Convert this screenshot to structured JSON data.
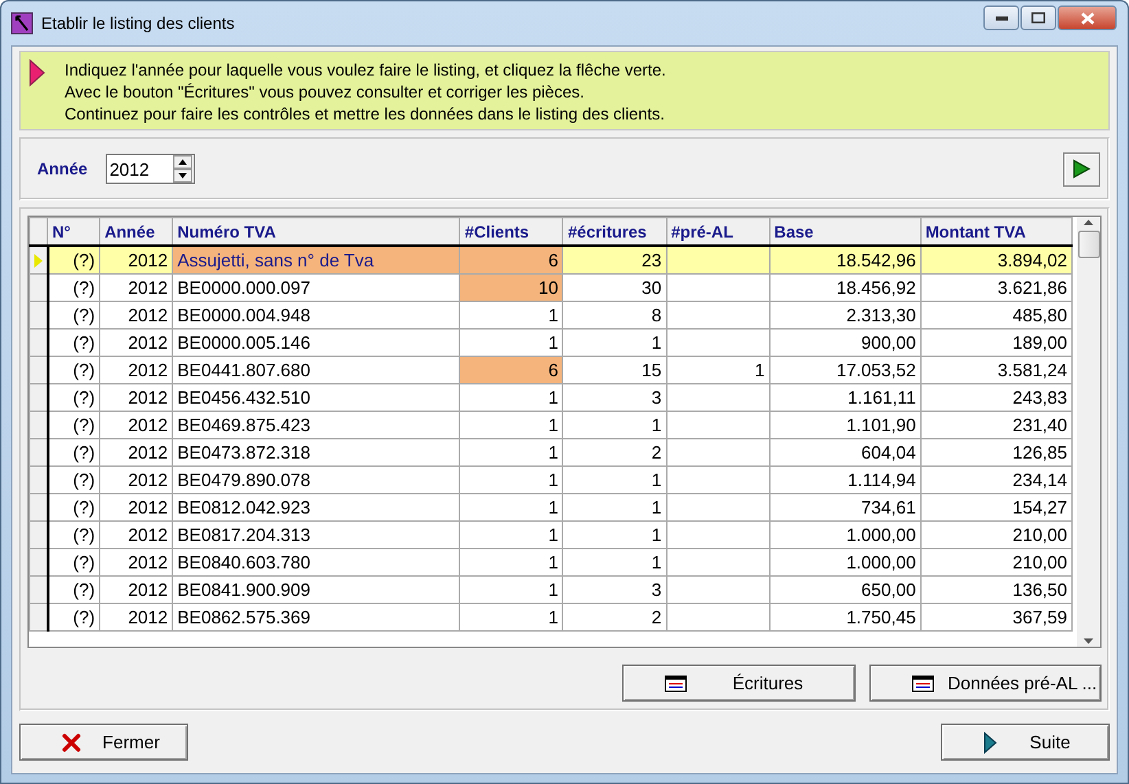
{
  "window": {
    "title": "Etablir le listing des clients"
  },
  "info": {
    "lines": [
      "Indiquez l'année pour laquelle vous voulez faire le listing, et cliquez la flêche verte.",
      "Avec le bouton \"Écritures\" vous pouvez consulter et corriger les pièces.",
      "Continuez pour faire les contrôles et mettre les données dans le listing des clients."
    ]
  },
  "year": {
    "label": "Année",
    "value": "2012"
  },
  "table": {
    "columns": [
      "N°",
      "Année",
      "Numéro TVA",
      "#Clients",
      "#écritures",
      "#pré-AL",
      "Base",
      "Montant TVA"
    ],
    "rows": [
      {
        "selected": true,
        "number": "(?)",
        "year": "2012",
        "vat_number": "Assujetti, sans n° de Tva",
        "vat_flag": true,
        "clients": "6",
        "clients_flag": true,
        "entries": "23",
        "base": "18.542,96",
        "vat_amount": "3.894,02"
      },
      {
        "selected": false,
        "number": "(?)",
        "year": "2012",
        "vat_number": "BE0000.000.097",
        "vat_flag": false,
        "clients": "10",
        "clients_flag": true,
        "entries": "30",
        "base": "18.456,92",
        "vat_amount": "3.621,86"
      },
      {
        "selected": false,
        "number": "(?)",
        "year": "2012",
        "vat_number": "BE0000.004.948",
        "vat_flag": false,
        "clients": "1",
        "clients_flag": false,
        "entries": "8",
        "base": "2.313,30",
        "vat_amount": "485,80"
      },
      {
        "selected": false,
        "number": "(?)",
        "year": "2012",
        "vat_number": "BE0000.005.146",
        "vat_flag": false,
        "clients": "1",
        "clients_flag": false,
        "entries": "1",
        "base": "900,00",
        "vat_amount": "189,00"
      },
      {
        "selected": false,
        "number": "(?)",
        "year": "2012",
        "vat_number": "BE0441.807.680",
        "vat_flag": false,
        "clients": "6",
        "clients_flag": true,
        "entries": "15",
        "pre_al": "1",
        "base": "17.053,52",
        "vat_amount": "3.581,24"
      },
      {
        "selected": false,
        "number": "(?)",
        "year": "2012",
        "vat_number": "BE0456.432.510",
        "vat_flag": false,
        "clients": "1",
        "clients_flag": false,
        "entries": "3",
        "base": "1.161,11",
        "vat_amount": "243,83"
      },
      {
        "selected": false,
        "number": "(?)",
        "year": "2012",
        "vat_number": "BE0469.875.423",
        "vat_flag": false,
        "clients": "1",
        "clients_flag": false,
        "entries": "1",
        "base": "1.101,90",
        "vat_amount": "231,40"
      },
      {
        "selected": false,
        "number": "(?)",
        "year": "2012",
        "vat_number": "BE0473.872.318",
        "vat_flag": false,
        "clients": "1",
        "clients_flag": false,
        "entries": "2",
        "base": "604,04",
        "vat_amount": "126,85"
      },
      {
        "selected": false,
        "number": "(?)",
        "year": "2012",
        "vat_number": "BE0479.890.078",
        "vat_flag": false,
        "clients": "1",
        "clients_flag": false,
        "entries": "1",
        "base": "1.114,94",
        "vat_amount": "234,14"
      },
      {
        "selected": false,
        "number": "(?)",
        "year": "2012",
        "vat_number": "BE0812.042.923",
        "vat_flag": false,
        "clients": "1",
        "clients_flag": false,
        "entries": "1",
        "base": "734,61",
        "vat_amount": "154,27"
      },
      {
        "selected": false,
        "number": "(?)",
        "year": "2012",
        "vat_number": "BE0817.204.313",
        "vat_flag": false,
        "clients": "1",
        "clients_flag": false,
        "entries": "1",
        "base": "1.000,00",
        "vat_amount": "210,00"
      },
      {
        "selected": false,
        "number": "(?)",
        "year": "2012",
        "vat_number": "BE0840.603.780",
        "vat_flag": false,
        "clients": "1",
        "clients_flag": false,
        "entries": "1",
        "base": "1.000,00",
        "vat_amount": "210,00"
      },
      {
        "selected": false,
        "number": "(?)",
        "year": "2012",
        "vat_number": "BE0841.900.909",
        "vat_flag": false,
        "clients": "1",
        "clients_flag": false,
        "entries": "3",
        "base": "650,00",
        "vat_amount": "136,50"
      },
      {
        "selected": false,
        "number": "(?)",
        "year": "2012",
        "vat_number": "BE0862.575.369",
        "vat_flag": false,
        "clients": "1",
        "clients_flag": false,
        "entries": "2",
        "base": "1.750,45",
        "vat_amount": "367,59"
      }
    ]
  },
  "grid_buttons": [
    {
      "label": "Écritures"
    },
    {
      "label": "Données pré-AL ..."
    }
  ],
  "footer_buttons": [
    {
      "label": "Fermer",
      "kind": "close"
    },
    {
      "label": "Suite",
      "kind": "next"
    }
  ]
}
